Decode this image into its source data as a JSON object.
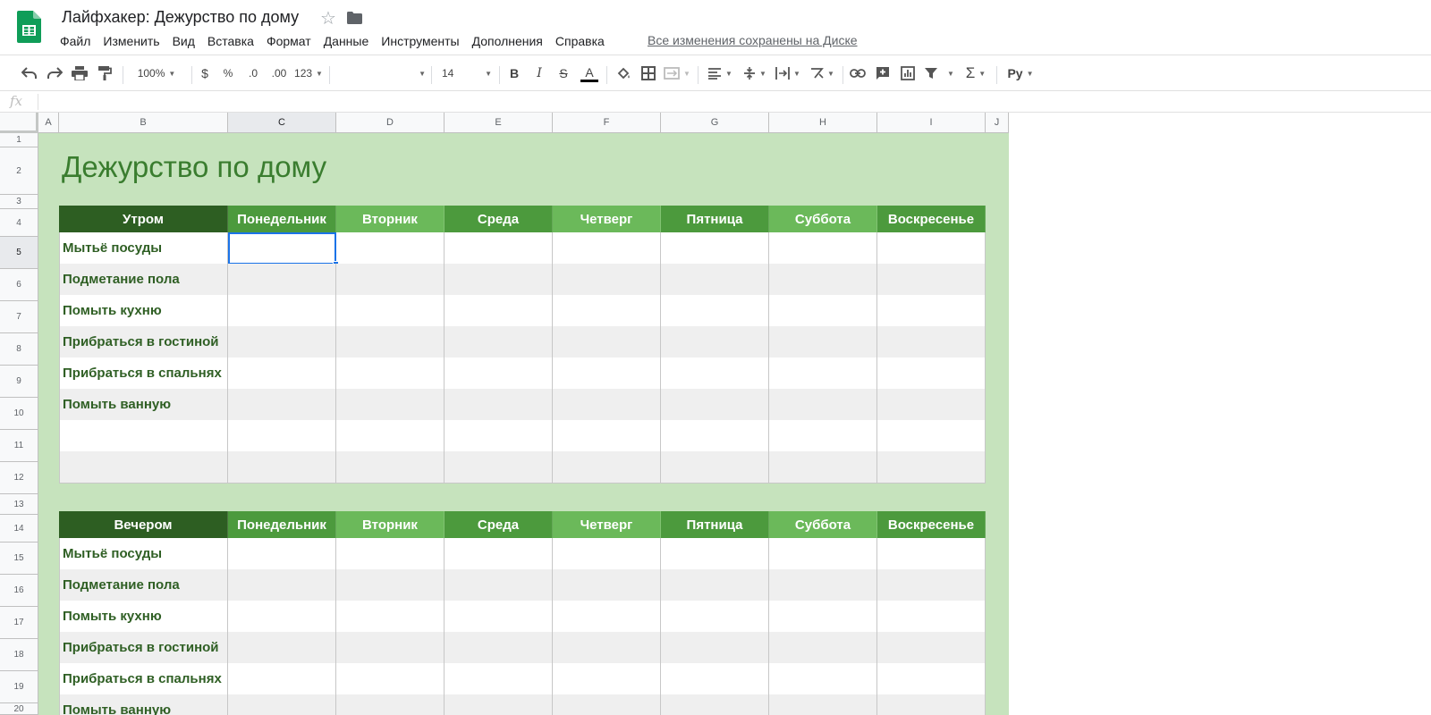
{
  "doc": {
    "title": "Лайфхакер: Дежурство по дому",
    "saved_status": "Все изменения сохранены на Диске"
  },
  "menu": [
    {
      "label": "Файл"
    },
    {
      "label": "Изменить"
    },
    {
      "label": "Вид"
    },
    {
      "label": "Вставка"
    },
    {
      "label": "Формат"
    },
    {
      "label": "Данные"
    },
    {
      "label": "Инструменты"
    },
    {
      "label": "Дополнения"
    },
    {
      "label": "Справка"
    }
  ],
  "toolbar": {
    "zoom": "100%",
    "currency": "$",
    "percent": "%",
    "decimal_decrease": ".0",
    "decimal_increase": ".00",
    "more_formats": "123",
    "font_family": "",
    "font_size": "14",
    "bold": "B",
    "italic": "I",
    "strike": "S",
    "text_color": "A",
    "input_tools": "Ру"
  },
  "formula_bar": {
    "fx": "fx",
    "value": ""
  },
  "grid": {
    "columns": [
      "A",
      "B",
      "C",
      "D",
      "E",
      "F",
      "G",
      "H",
      "I",
      "J"
    ],
    "active_column": "C",
    "rows": [
      "1",
      "2",
      "3",
      "4",
      "5",
      "6",
      "7",
      "8",
      "9",
      "10",
      "11",
      "12",
      "13",
      "14",
      "15",
      "16",
      "17",
      "18",
      "19",
      "20"
    ],
    "active_row": "5"
  },
  "sheet": {
    "title": "Дежурство по дому",
    "colors": {
      "background": "#c6e3bd",
      "title": "#3a7d2f",
      "header_dark": "#2d5e22",
      "header_mid": "#4c9a3d",
      "header_light": "#6bb95a",
      "label": "#2f5f24"
    },
    "days": [
      "Понедельник",
      "Вторник",
      "Среда",
      "Четверг",
      "Пятница",
      "Суббота",
      "Воскресенье"
    ],
    "morning": {
      "header": "Утром",
      "tasks": [
        "Мытьё посуды",
        "Подметание пола",
        "Помыть кухню",
        "Прибраться в гостиной",
        "Прибраться в спальнях",
        "Помыть ванную",
        "",
        ""
      ]
    },
    "evening": {
      "header": "Вечером",
      "tasks": [
        "Мытьё посуды",
        "Подметание пола",
        "Помыть кухню",
        "Прибраться в гостиной",
        "Прибраться в спальнях",
        "Помыть ванную"
      ]
    }
  }
}
